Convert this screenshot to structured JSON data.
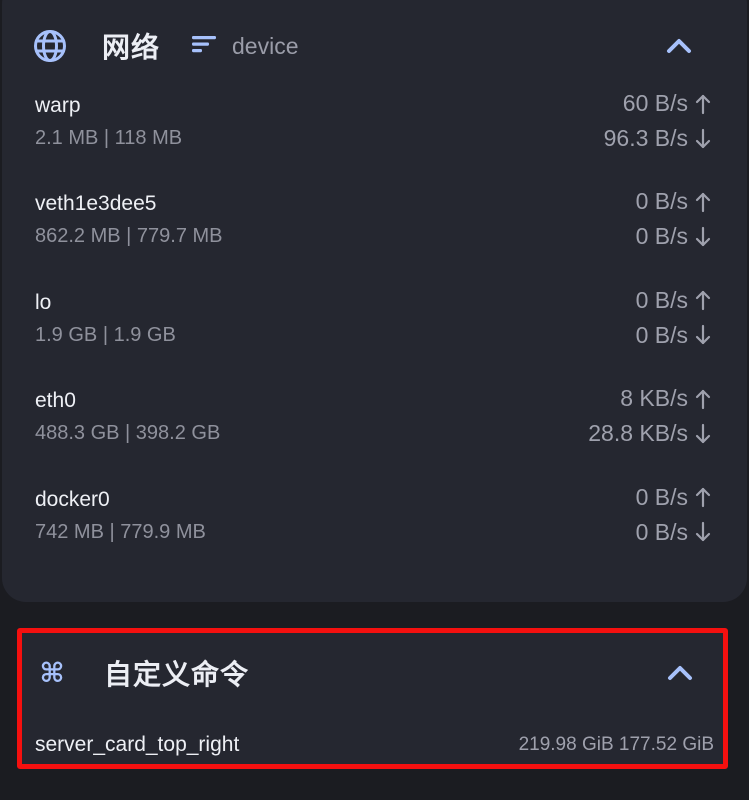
{
  "network": {
    "title": "网络",
    "icon": "globe-icon",
    "sort_icon": "sort-icon",
    "sort_label": "device",
    "collapse_icon": "chevron-up-icon",
    "interfaces": [
      {
        "name": "warp",
        "total": "2.1 MB | 118 MB",
        "up": "60 B/s",
        "down": "96.3 B/s"
      },
      {
        "name": "veth1e3dee5",
        "total": "862.2 MB | 779.7 MB",
        "up": "0 B/s",
        "down": "0 B/s"
      },
      {
        "name": "lo",
        "total": "1.9 GB | 1.9 GB",
        "up": "0 B/s",
        "down": "0 B/s"
      },
      {
        "name": "eth0",
        "total": "488.3 GB | 398.2 GB",
        "up": "8 KB/s",
        "down": "28.8 KB/s"
      },
      {
        "name": "docker0",
        "total": "742 MB | 779.9 MB",
        "up": "0 B/s",
        "down": "0 B/s"
      }
    ]
  },
  "custom_command": {
    "title": "自定义命令",
    "icon": "command-key-icon",
    "icon_glyph": "⌘",
    "collapse_icon": "chevron-up-icon",
    "items": [
      {
        "name": "server_card_top_right",
        "value": "219.98 GiB 177.52 GiB"
      }
    ]
  },
  "colors": {
    "background": "#1b1c21",
    "card": "#252730",
    "accent": "#a7c1fb",
    "highlight_border": "#f5100f"
  }
}
